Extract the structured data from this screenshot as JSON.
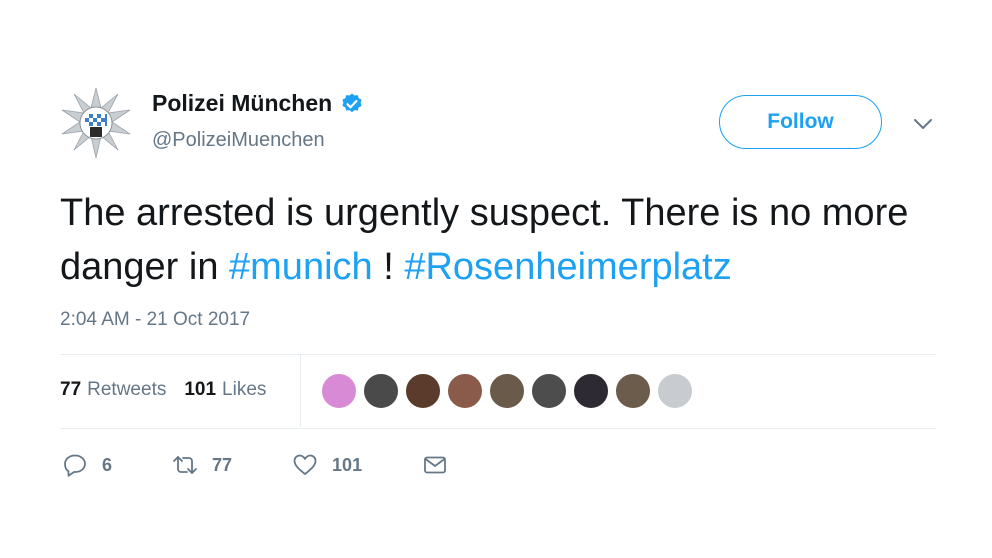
{
  "author": {
    "name": "Polizei München",
    "handle": "@PolizeiMuenchen",
    "verified_icon": "verified-badge-icon",
    "avatar_icon": "police-star-emblem"
  },
  "follow_button": {
    "label": "Follow"
  },
  "menu_icon": "chevron-down-icon",
  "tweet": {
    "text_part1": "The arrested is urgently suspect. There is no more danger in ",
    "hashtag1": "#munich",
    "text_part2": " ! ",
    "hashtag2": "#Rosenheimerplatz",
    "timestamp": "2:04 AM - 21 Oct 2017"
  },
  "stats": {
    "retweets_count": "77",
    "retweets_label": "Retweets",
    "likes_count": "101",
    "likes_label": "Likes"
  },
  "likers": [
    {
      "color": "#d98ad4"
    },
    {
      "color": "#4a4a4a"
    },
    {
      "color": "#5b3b2c"
    },
    {
      "color": "#8a5a4a"
    },
    {
      "color": "#6a5a4a"
    },
    {
      "color": "#4d4d4d"
    },
    {
      "color": "#2e2a33"
    },
    {
      "color": "#6b5c4b"
    },
    {
      "color": "#c8ccd0"
    }
  ],
  "actions": {
    "reply_count": "6",
    "retweet_count": "77",
    "like_count": "101"
  },
  "colors": {
    "accent": "#1da1f2",
    "secondary_text": "#657786",
    "divider": "#e6ecf0"
  }
}
